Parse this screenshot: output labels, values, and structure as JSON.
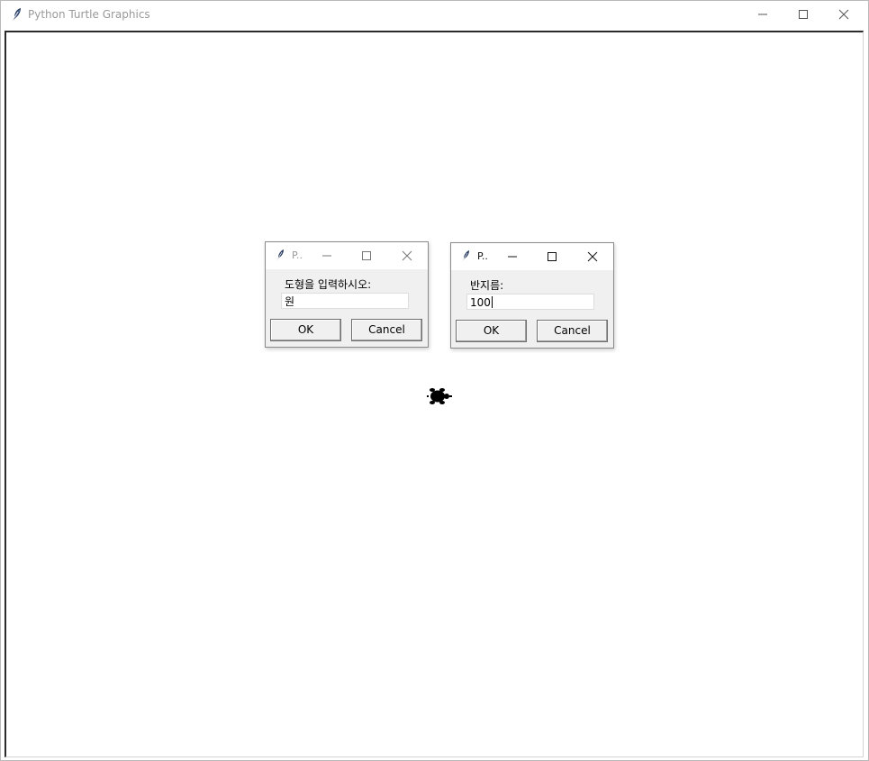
{
  "window": {
    "title": "Python Turtle Graphics",
    "controls": [
      "minimize",
      "maximize",
      "close"
    ]
  },
  "dialogs": [
    {
      "title": "P..",
      "state": "inactive",
      "prompt": "도형을 입력하시오:",
      "value": "원",
      "ok_label": "OK",
      "cancel_label": "Cancel"
    },
    {
      "title": "P..",
      "state": "active",
      "prompt": "반지름:",
      "value": "100",
      "ok_label": "OK",
      "cancel_label": "Cancel"
    }
  ],
  "canvas": {
    "turtle_icon": "turtle-icon",
    "background": "#ffffff"
  },
  "colors": {
    "titlebar": "#ffffff",
    "dialog_body": "#f0f0f0",
    "inactive_text": "#999999",
    "canvas_border": "#2b2b2b"
  }
}
